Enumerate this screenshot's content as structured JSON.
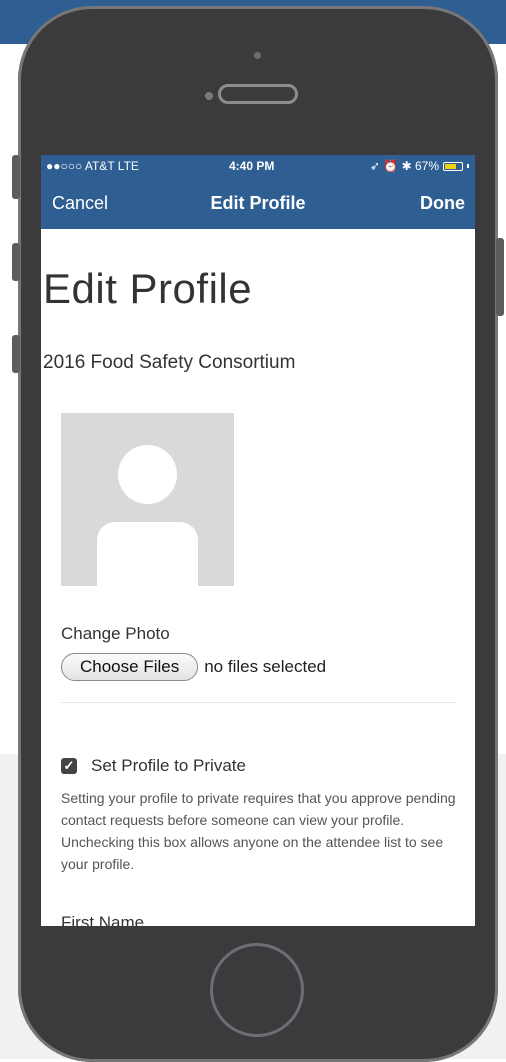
{
  "status_bar": {
    "carrier": "●●○○○ AT&T  LTE",
    "time": "4:40 PM",
    "indicators": "➶ ⏰ ✱ 67%",
    "battery_level": 0.67
  },
  "nav": {
    "cancel_label": "Cancel",
    "title": "Edit Profile",
    "done_label": "Done"
  },
  "page": {
    "heading": "Edit Profile",
    "event_name": "2016 Food Safety Consortium",
    "change_photo_label": "Change Photo",
    "choose_files_label": "Choose Files",
    "file_status": "no files selected",
    "private_checkbox_mark": "✓",
    "private_label": "Set Profile to Private",
    "private_description": "Setting your profile to private requires that you approve pending contact requests before someone can view your profile. Unchecking this box allows anyone on the attendee list to see your profile.",
    "first_name_label": "First Name"
  },
  "icons": {
    "avatar": "avatar-placeholder-icon",
    "checkbox": "checkbox-checked-icon",
    "battery": "battery-icon"
  },
  "colors": {
    "nav_blue": "#2f5e92",
    "battery_yellow": "#f4d10a"
  }
}
